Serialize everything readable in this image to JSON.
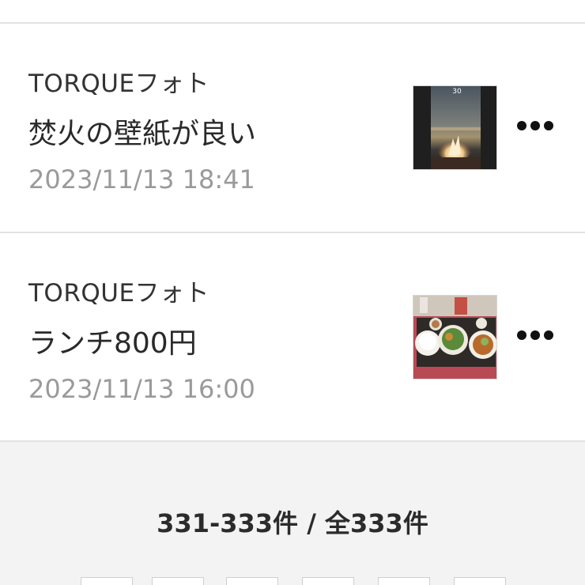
{
  "posts": [
    {
      "source": "TORQUEフォト",
      "title": "焚火の壁紙が良い",
      "date": "2023/11/13 18:41",
      "thumb_label": "30",
      "thumb_icon": "bonfire-photo",
      "more_icon": "more-dots-icon"
    },
    {
      "source": "TORQUEフォト",
      "title": "ランチ800円",
      "date": "2023/11/13 16:00",
      "thumb_icon": "lunch-photo",
      "more_icon": "more-dots-icon"
    }
  ],
  "pagination": {
    "count_text": "331-333件 / 全333件"
  },
  "colors": {
    "divider": "#e2e2e2",
    "footer_bg": "#f3f3f3",
    "date_text": "#9a9a9a"
  }
}
